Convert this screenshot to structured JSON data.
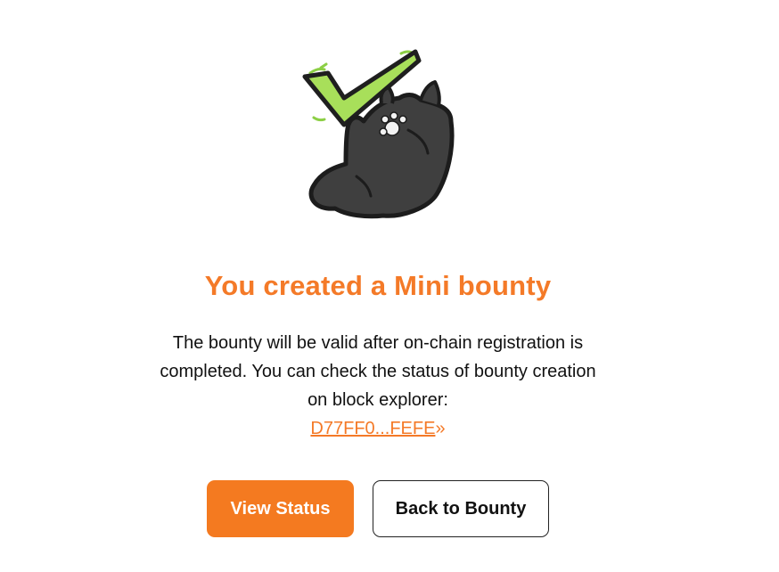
{
  "illustration": {
    "icon": "cat-with-checkmark-icon"
  },
  "result": {
    "title": "You created a Mini bounty",
    "description": "The bounty will be valid after on-chain registration is completed. You can check the status of bounty creation on block explorer:",
    "tx_link_text": "D77FF0...FEFE",
    "tx_link_arrow": "»"
  },
  "actions": {
    "view_status_label": "View Status",
    "back_to_bounty_label": "Back to Bounty"
  },
  "colors": {
    "accent": "#f47a28",
    "primary_button": "#f47a20",
    "check_green": "#a8df5a",
    "cat_body": "#3f3f3f"
  }
}
